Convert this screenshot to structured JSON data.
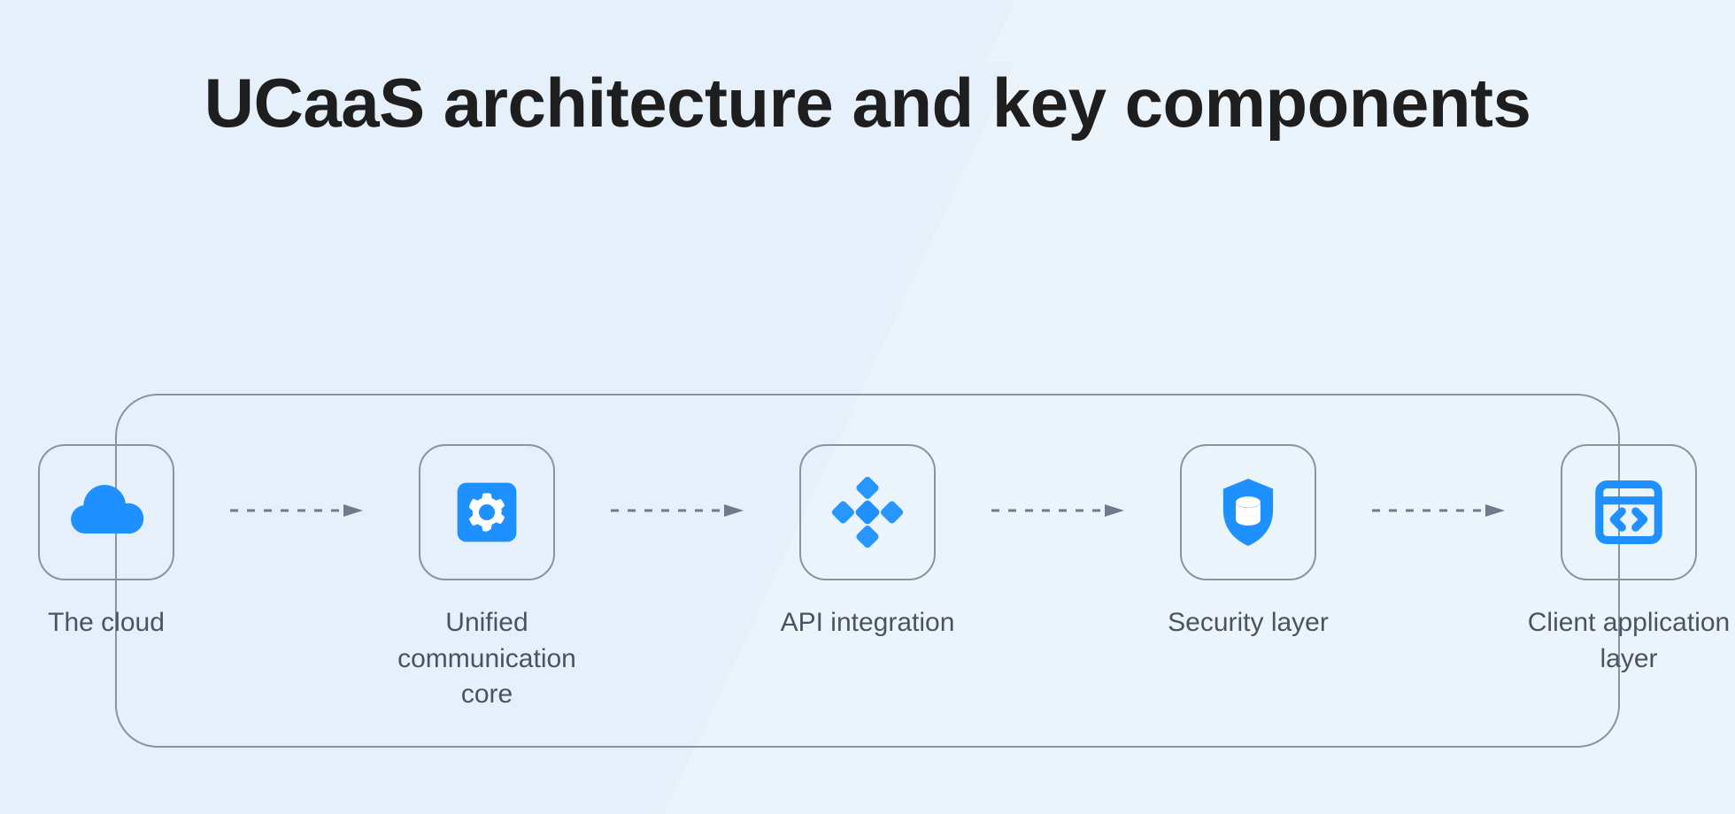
{
  "title": "UCaaS architecture and key components",
  "nodes": [
    {
      "label": "The cloud",
      "icon": "cloud-icon"
    },
    {
      "label": "Unified communication core",
      "icon": "gear-icon"
    },
    {
      "label": "API integration",
      "icon": "api-icon"
    },
    {
      "label": "Security layer",
      "icon": "shield-db-icon"
    },
    {
      "label": "Client application layer",
      "icon": "code-window-icon"
    }
  ],
  "colors": {
    "accent": "#1e90ff",
    "border": "#8a93a6",
    "text_dark": "#1e1e1e",
    "text_grey": "#4a5264",
    "arrow": "#717a8c"
  }
}
